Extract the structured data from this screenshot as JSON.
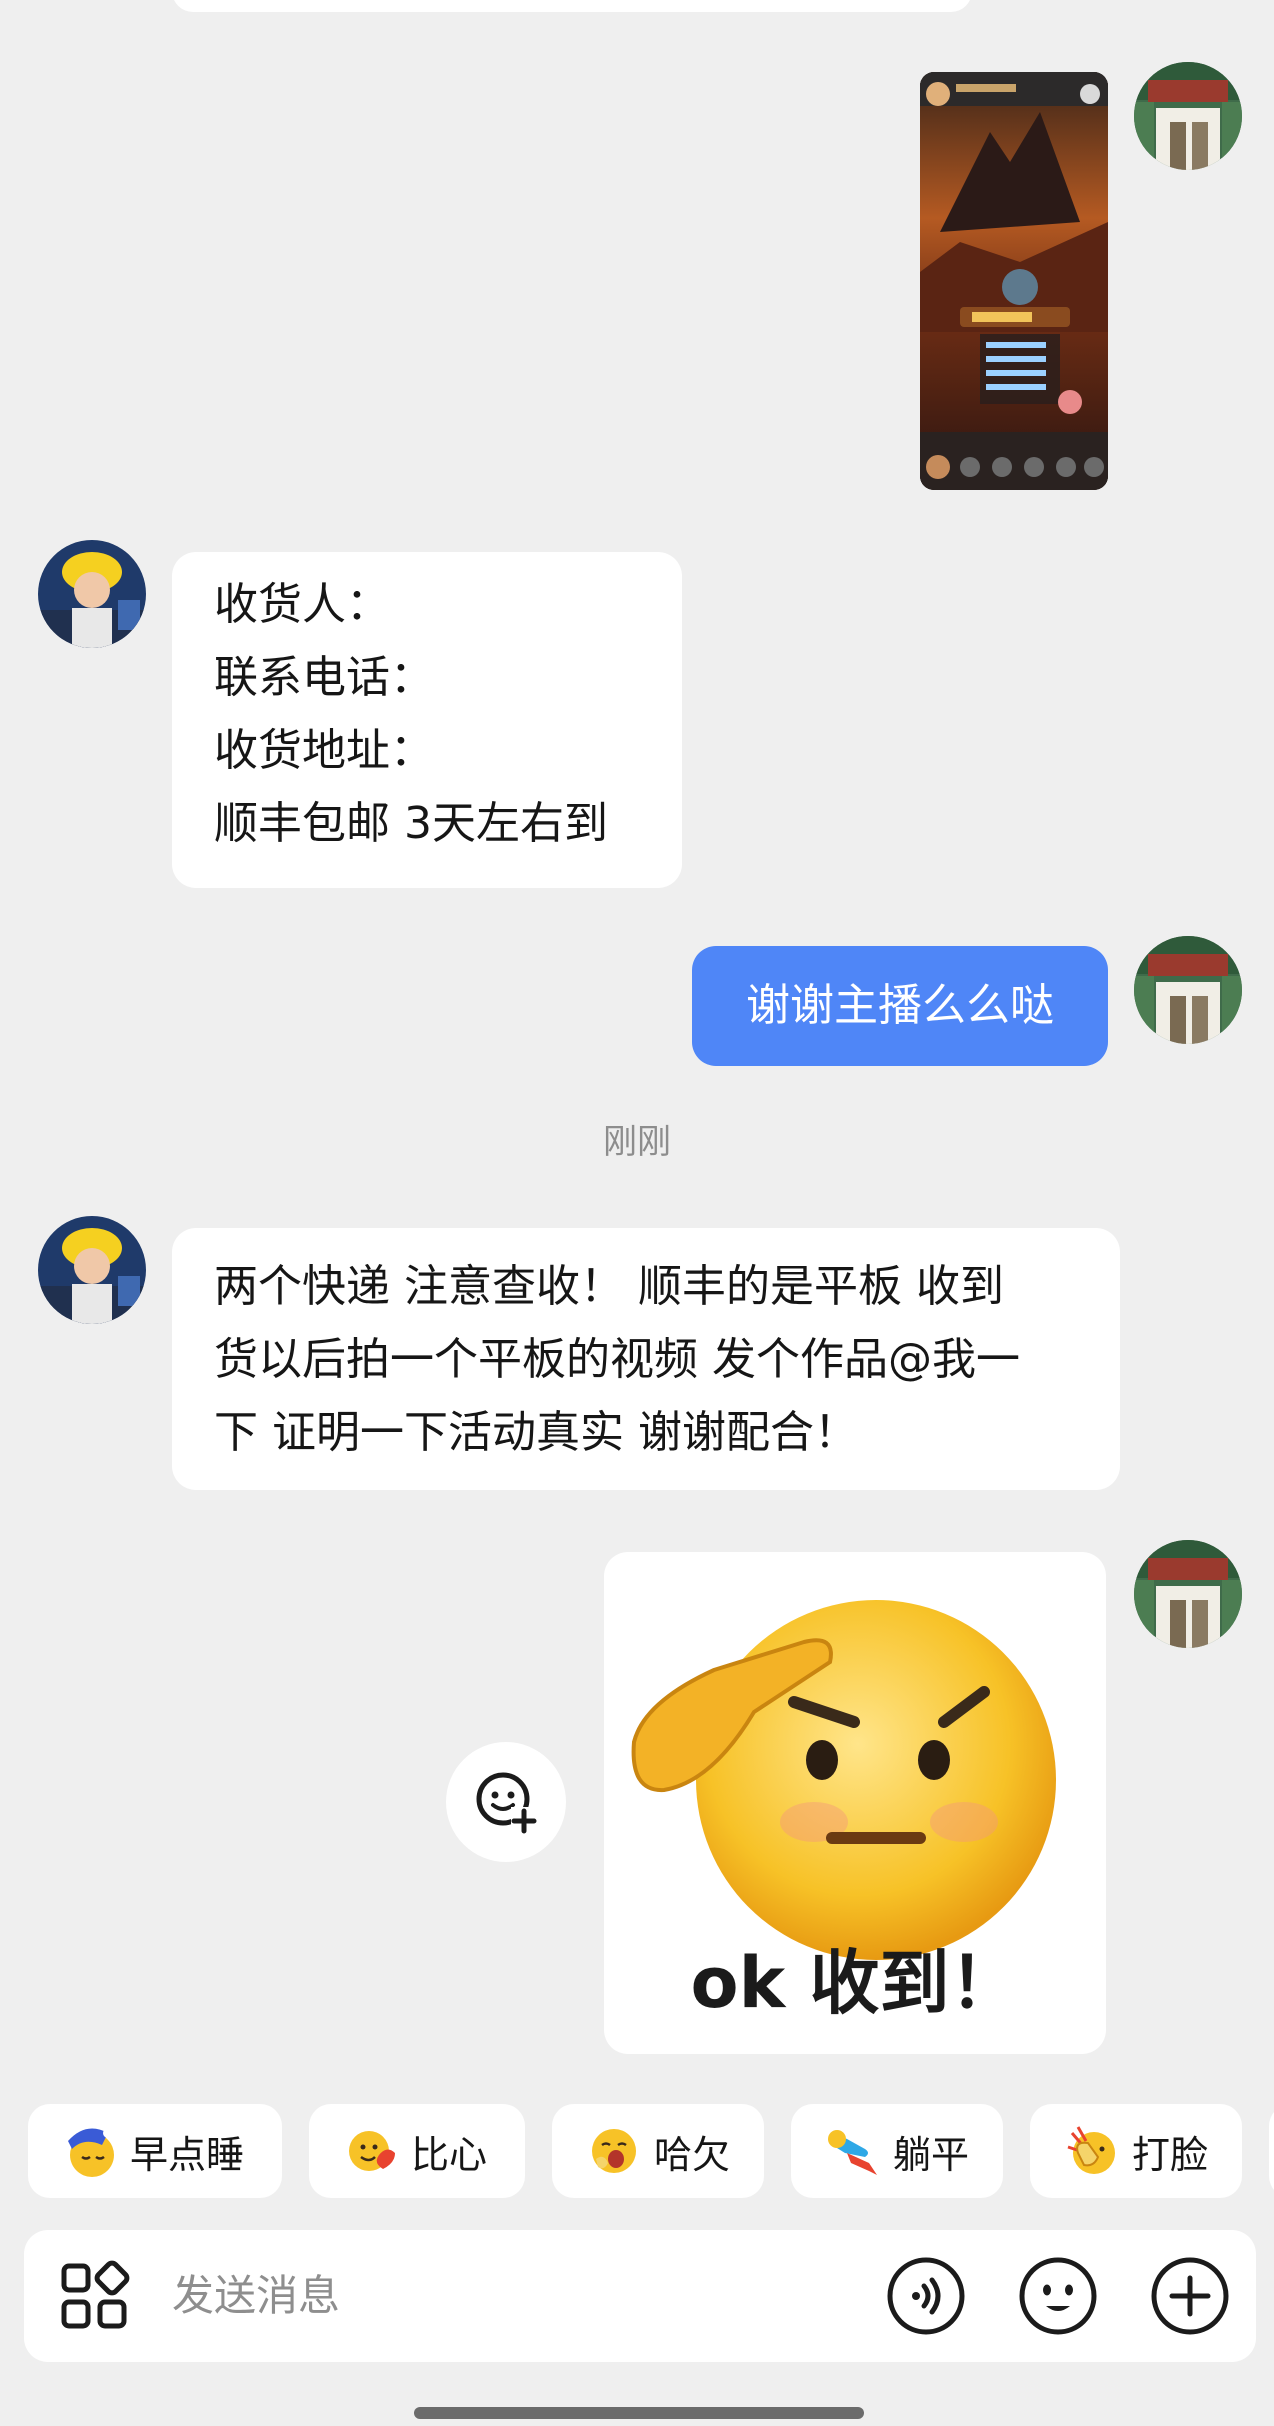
{
  "messages": {
    "address_form": {
      "lines": [
        "收货人：",
        "联系电话：",
        "收货地址：",
        "顺丰包邮 3天左右到"
      ]
    },
    "thanks_reply": "谢谢主播么么哒",
    "timestamp": "刚刚",
    "shipping_notice": {
      "lines": [
        "两个快递 注意查收！ 顺丰的是平板 收到",
        "货以后拍一个平板的视频 发个作品@我一",
        "下 证明一下活动真实 谢谢配合！"
      ]
    },
    "sticker_text": "ok 收到！"
  },
  "quick_replies": [
    {
      "label": "早点睡",
      "icon": "sleepy-moon-emoji"
    },
    {
      "label": "比心",
      "icon": "heart-hands-emoji"
    },
    {
      "label": "哈欠",
      "icon": "yawn-emoji"
    },
    {
      "label": "躺平",
      "icon": "lying-flat-emoji"
    },
    {
      "label": "打脸",
      "icon": "face-slap-emoji"
    }
  ],
  "input": {
    "placeholder": "发送消息"
  },
  "colors": {
    "background": "#efefef",
    "sent_bubble": "#4f86f7",
    "received_bubble": "#ffffff"
  }
}
